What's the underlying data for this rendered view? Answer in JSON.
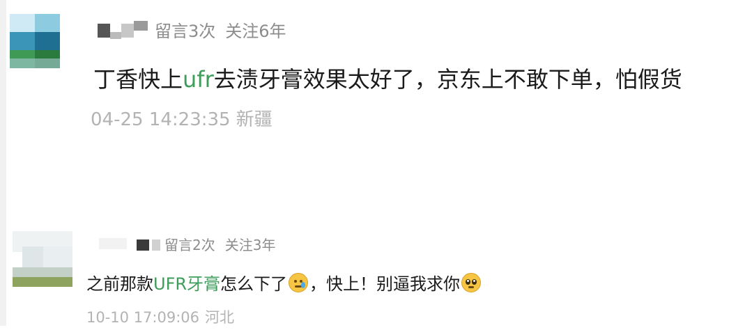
{
  "comments": [
    {
      "meta": {
        "messages": "留言3次",
        "follow": "关注6年"
      },
      "content": {
        "before": "丁香快上",
        "highlight": "ufr",
        "after": "去渍牙膏效果太好了，京东上不敢下单，怕假货"
      },
      "footer": {
        "time": "04-25 14:23:35",
        "location": "新疆"
      }
    },
    {
      "meta": {
        "messages": "留言2次",
        "follow": "关注3年"
      },
      "content": {
        "before": "之前那款",
        "highlight": "UFR牙膏",
        "middle": "怎么下了",
        "after": "，快上！别逼我求你"
      },
      "footer": {
        "time": "10-10 17:09:06",
        "location": "河北"
      }
    }
  ],
  "colors": {
    "highlight": "#3e9d5a",
    "meta": "#8c8c8c",
    "footer": "#b3b3b3"
  },
  "icons": {
    "emoji1": "crying-face-emoji",
    "emoji2": "pleading-face-emoji"
  }
}
